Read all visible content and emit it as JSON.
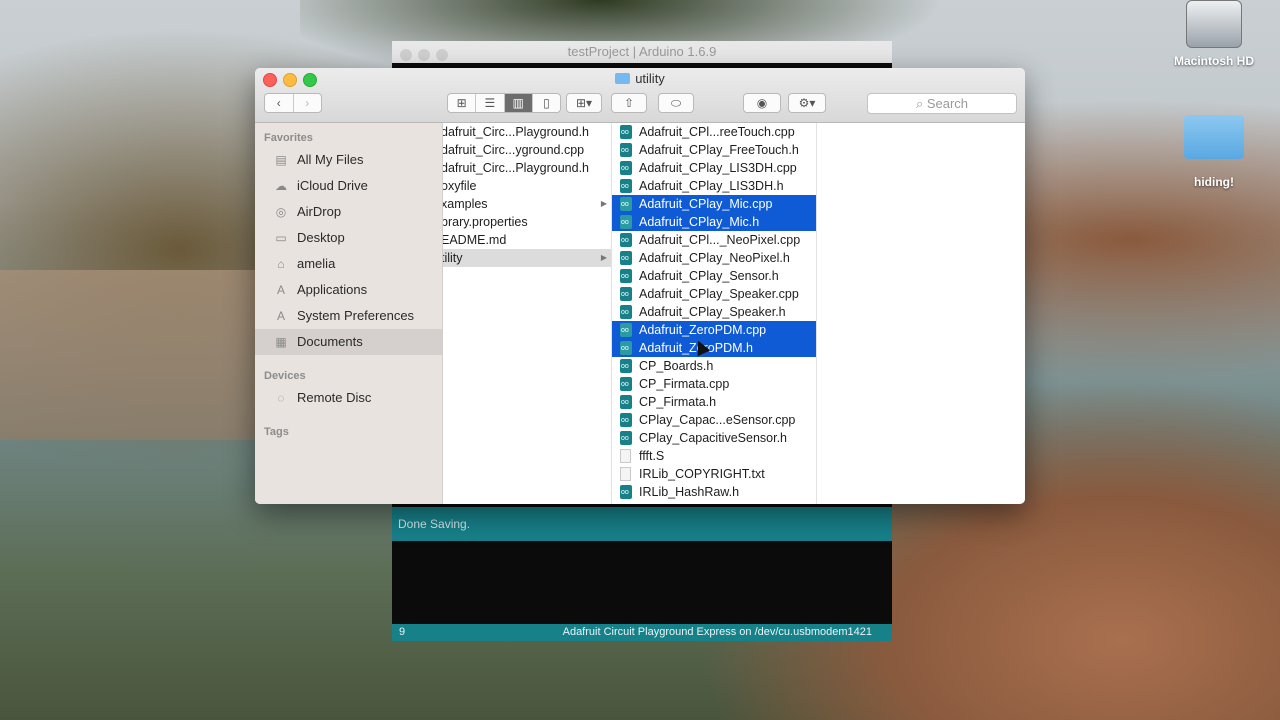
{
  "desktop": {
    "icons": [
      {
        "label": "Macintosh HD"
      },
      {
        "label": "hiding!"
      }
    ]
  },
  "arduino": {
    "title": "testProject | Arduino 1.6.9",
    "console_message": "Done Saving.",
    "status_line": "9",
    "status_board": "Adafruit Circuit Playground Express on /dev/cu.usbmodem1421"
  },
  "finder": {
    "title": "utility",
    "search_placeholder": "Search",
    "sidebar": {
      "favorites_header": "Favorites",
      "favorites": [
        {
          "label": "All My Files",
          "icon": "all-files-icon"
        },
        {
          "label": "iCloud Drive",
          "icon": "cloud-icon"
        },
        {
          "label": "AirDrop",
          "icon": "airdrop-icon"
        },
        {
          "label": "Desktop",
          "icon": "desktop-icon"
        },
        {
          "label": "amelia",
          "icon": "home-icon"
        },
        {
          "label": "Applications",
          "icon": "applications-icon"
        },
        {
          "label": "System Preferences",
          "icon": "applications-icon"
        },
        {
          "label": "Documents",
          "icon": "documents-icon"
        }
      ],
      "devices_header": "Devices",
      "devices": [
        {
          "label": "Remote Disc",
          "icon": "disc-icon"
        }
      ],
      "tags_header": "Tags"
    },
    "column1": [
      {
        "name": "dafruit_Circ...Playground.h"
      },
      {
        "name": "dafruit_Circ...yground.cpp"
      },
      {
        "name": "dafruit_Circ...Playground.h"
      },
      {
        "name": "oxyfile"
      },
      {
        "name": "xamples"
      },
      {
        "name": "brary.properties"
      },
      {
        "name": "EADME.md"
      },
      {
        "name": "tility"
      }
    ],
    "column2": [
      {
        "name": "Adafruit_CPl...reeTouch.cpp"
      },
      {
        "name": "Adafruit_CPlay_FreeTouch.h"
      },
      {
        "name": "Adafruit_CPlay_LIS3DH.cpp"
      },
      {
        "name": "Adafruit_CPlay_LIS3DH.h"
      },
      {
        "name": "Adafruit_CPlay_Mic.cpp"
      },
      {
        "name": "Adafruit_CPlay_Mic.h"
      },
      {
        "name": "Adafruit_CPl..._NeoPixel.cpp"
      },
      {
        "name": "Adafruit_CPlay_NeoPixel.h"
      },
      {
        "name": "Adafruit_CPlay_Sensor.h"
      },
      {
        "name": "Adafruit_CPlay_Speaker.cpp"
      },
      {
        "name": "Adafruit_CPlay_Speaker.h"
      },
      {
        "name": "Adafruit_ZeroPDM.cpp"
      },
      {
        "name": "Adafruit_ZeroPDM.h"
      },
      {
        "name": "CP_Boards.h"
      },
      {
        "name": "CP_Firmata.cpp"
      },
      {
        "name": "CP_Firmata.h"
      },
      {
        "name": "CPlay_Capac...eSensor.cpp"
      },
      {
        "name": "CPlay_CapacitiveSensor.h"
      },
      {
        "name": "ffft.S"
      },
      {
        "name": "IRLib_COPYRIGHT.txt"
      },
      {
        "name": "IRLib_HashRaw.h"
      }
    ]
  }
}
